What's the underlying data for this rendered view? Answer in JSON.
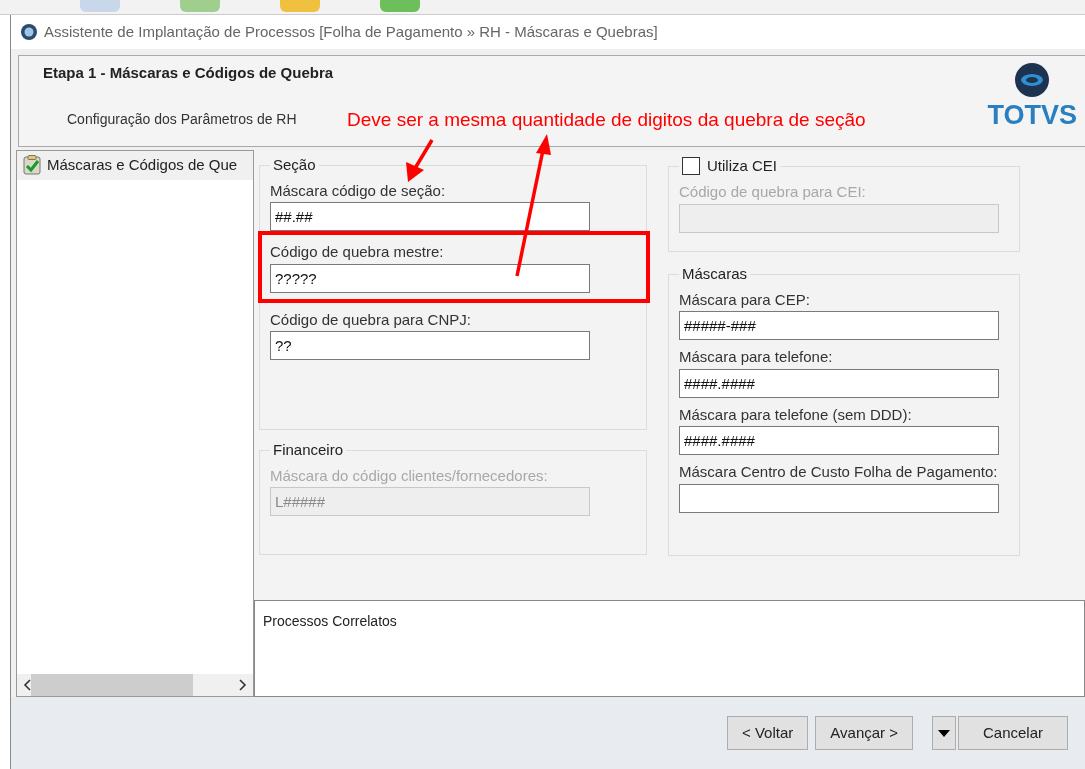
{
  "window": {
    "title": "Assistente de Implantação de Processos [Folha de Pagamento » RH - Máscaras e Quebras]"
  },
  "header": {
    "step_title": "Etapa 1 - Máscaras e Códigos de Quebra",
    "subtitle": "Configuração dos Parâmetros de RH",
    "logo_text": "TOTVS"
  },
  "annotation": {
    "text": "Deve ser a mesma quantidade de digitos da quebra de seção"
  },
  "sidebar": {
    "items": [
      {
        "label": "Máscaras e Códigos de Que",
        "selected": true
      }
    ]
  },
  "left_groups": [
    {
      "title": "Seção",
      "disabled": false,
      "fields": [
        {
          "label": "Máscara código de seção:",
          "value": "##.##",
          "highlighted": false
        },
        {
          "label": "Código de quebra mestre:",
          "value": "?????",
          "highlighted": true
        },
        {
          "label": "Código de quebra para CNPJ:",
          "value": "??",
          "highlighted": false
        }
      ]
    },
    {
      "title": "Financeiro",
      "disabled": true,
      "fields": [
        {
          "label": "Máscara do código clientes/fornecedores:",
          "value": "L#####",
          "highlighted": false
        }
      ]
    }
  ],
  "cei_group": {
    "checkbox_label": "Utiliza CEI",
    "checked": false,
    "disabled": true,
    "fields": [
      {
        "label": "Código de quebra para CEI:",
        "highlighted": false
      }
    ]
  },
  "masks_group": {
    "title": "Máscaras",
    "disabled": false,
    "fields": [
      {
        "label": "Máscara para CEP:",
        "value": "#####-###",
        "highlighted": false
      },
      {
        "label": "Máscara para telefone:",
        "value": "####.####",
        "highlighted": false
      },
      {
        "label": "Máscara para telefone (sem DDD):",
        "value": "####.####",
        "highlighted": false
      },
      {
        "label": "Máscara Centro de Custo Folha de Pagamento:",
        "highlighted": false
      }
    ]
  },
  "related_processes": {
    "title": "Processos Correlatos"
  },
  "buttons": [
    {
      "label": "< Voltar",
      "kind": "button"
    },
    {
      "label": "Avançar >",
      "kind": "button"
    },
    {
      "kind": "dropdown"
    },
    {
      "label": "Cancelar",
      "kind": "button"
    }
  ]
}
